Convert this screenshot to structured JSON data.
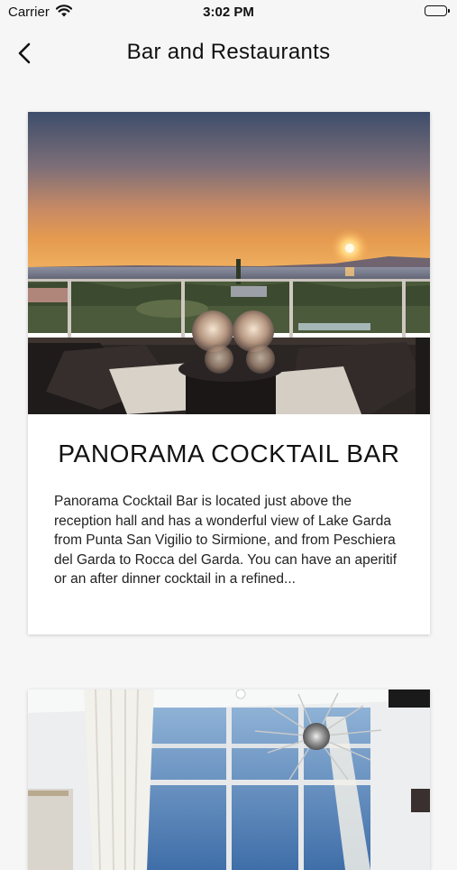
{
  "status": {
    "carrier": "Carrier",
    "time": "3:02 PM"
  },
  "nav": {
    "title": "Bar and Restaurants",
    "back_icon": "chevron-left-icon"
  },
  "cards": [
    {
      "title": "PANORAMA COCKTAIL BAR",
      "description": "Panorama Cocktail Bar is located just above the reception hall and has a wonderful view of Lake Garda from Punta San Vigilio to Sirmione, and from Peschiera del Garda to Rocca del Garda. You can have an aperitif or an after dinner cocktail in a refined...",
      "image": "sunset-terrace-photo"
    },
    {
      "image": "restaurant-interior-photo"
    }
  ]
}
